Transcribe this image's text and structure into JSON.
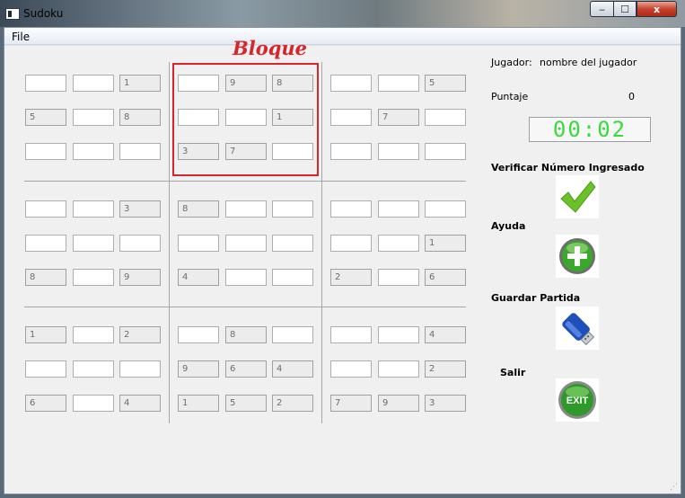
{
  "window": {
    "title": "Sudoku",
    "controls": {
      "minimize": "‒",
      "maximize": "☐",
      "close": "x"
    }
  },
  "menu": {
    "file": "File"
  },
  "annotation": {
    "label": "Bloque",
    "color": "#d7262b"
  },
  "board": {
    "rows": [
      [
        "",
        "",
        "1",
        "",
        "9",
        "8",
        "",
        "",
        "5"
      ],
      [
        "5",
        "",
        "8",
        "",
        "",
        "1",
        "",
        "7",
        ""
      ],
      [
        "",
        "",
        "",
        "3",
        "7",
        "",
        "",
        "",
        ""
      ],
      [
        "",
        "",
        "3",
        "8",
        "",
        "",
        "",
        "",
        ""
      ],
      [
        "",
        "",
        "",
        "",
        "",
        "",
        "",
        "",
        "1"
      ],
      [
        "8",
        "",
        "9",
        "4",
        "",
        "",
        "2",
        "",
        "6"
      ],
      [
        "1",
        "",
        "2",
        "",
        "8",
        "",
        "",
        "",
        "4"
      ],
      [
        "",
        "",
        "",
        "9",
        "6",
        "4",
        "",
        "",
        "2"
      ],
      [
        "6",
        "",
        "4",
        "1",
        "5",
        "2",
        "7",
        "9",
        "3"
      ]
    ]
  },
  "panel": {
    "player_label": "Jugador:",
    "player_name": "nombre del jugador",
    "score_label": "Puntaje",
    "score_value": "0",
    "timer": "00:02",
    "verify_label": "Verificar Número Ingresado",
    "help_label": "Ayuda",
    "save_label": "Guardar Partida",
    "exit_label": "Salir",
    "exit_icon_text": "EXIT"
  },
  "colors": {
    "timer_digits": "#3ad93f",
    "check_green": "#6cc02a",
    "help_green": "#3aa82a",
    "save_blue": "#1f4fb8",
    "exit_green": "#2f9a2a"
  }
}
